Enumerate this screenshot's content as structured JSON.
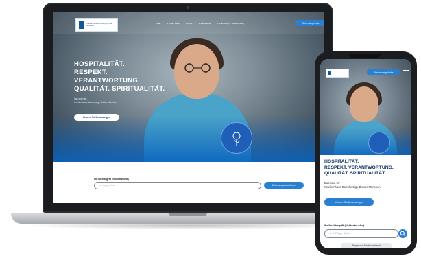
{
  "brand": {
    "primary": "#0d58a3",
    "accent": "#2a7fd1",
    "hero_blue": "#1f5fb8"
  },
  "desktop": {
    "logo_text": "Krankenhaus Barmherzige Brüder München",
    "nav": [
      "Start",
      "+ Unser Haus",
      "+ Klinik",
      "+ Sterbeklinik",
      "+ Ausbildung & Weiterbildung"
    ],
    "cta": "Stellenangebote",
    "headline": [
      "HOSPITALITÄT.",
      "RESPEKT.",
      "VERANTWORTUNG.",
      "QUALITÄT. SPIRITUALITÄT."
    ],
    "subline": [
      "Das sind wir -",
      "Krankenhaus Barmherzige Brüder München"
    ],
    "hero_button": "Unsere Stellenanzeigen",
    "search_label": "Ihr Suchbegriff (Volltextsuche)",
    "search_placeholder": "z.B. Pflege, Ärztin",
    "search_button": "Stellenangebote finden"
  },
  "mobile": {
    "cta": "Stellenangebote",
    "headline": [
      "HOSPITALITÄT.",
      "RESPEKT. VERANTWORTUNG.",
      "QUALITÄT. SPIRITUALITÄT."
    ],
    "subline": [
      "Das sind wir -",
      "Krankenhaus Barmherzige Brüder München"
    ],
    "button": "Unsere Stellenanzeigen",
    "search_label": "Ihr Suchbegriff (Volltextsuche)",
    "search_placeholder": "z.B. Pflege, Ärztin",
    "bottom_link": "Pflege und Funktionsdienst"
  }
}
